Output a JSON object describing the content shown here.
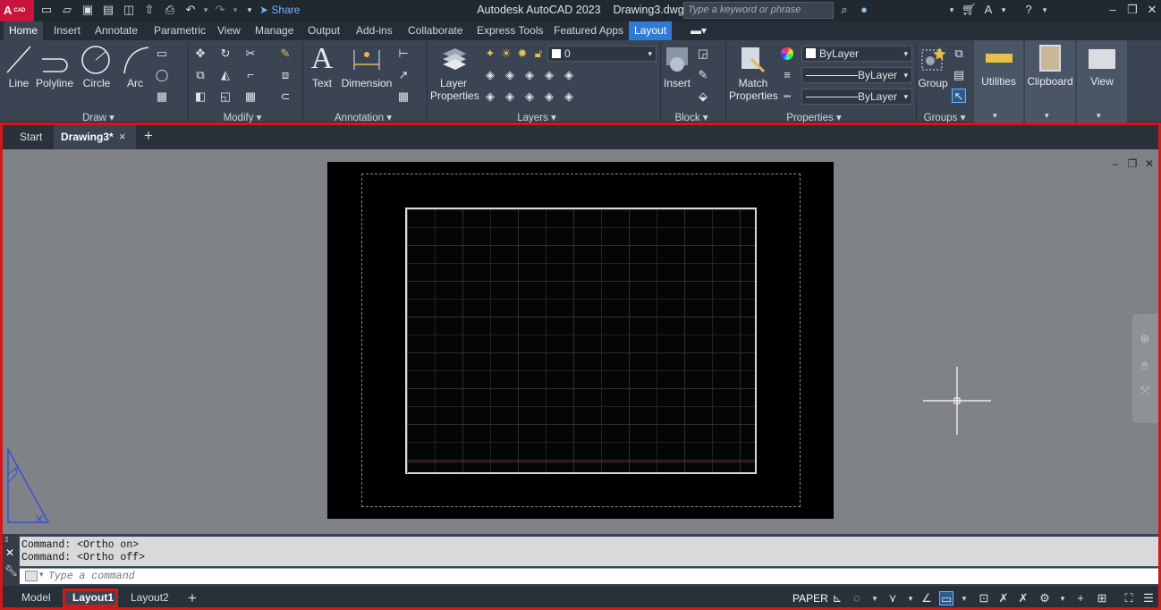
{
  "titlebar": {
    "logo": "A",
    "logo_sub": "CAD",
    "share": "Share",
    "app_title": "Autodesk AutoCAD 2023",
    "file_name": "Drawing3.dwg",
    "search_placeholder": "Type a keyword or phrase"
  },
  "ribbon_tabs": [
    "Home",
    "Insert",
    "Annotate",
    "Parametric",
    "View",
    "Manage",
    "Output",
    "Add-ins",
    "Collaborate",
    "Express Tools",
    "Featured Apps",
    "Layout"
  ],
  "ribbon": {
    "draw": {
      "label": "Draw",
      "line": "Line",
      "polyline": "Polyline",
      "circle": "Circle",
      "arc": "Arc"
    },
    "modify": {
      "label": "Modify"
    },
    "annotation": {
      "label": "Annotation",
      "text": "Text",
      "dimension": "Dimension"
    },
    "layers": {
      "label": "Layers",
      "layer_properties_1": "Layer",
      "layer_properties_2": "Properties",
      "current_layer": "0"
    },
    "block": {
      "label": "Block",
      "insert": "Insert"
    },
    "properties": {
      "label": "Properties",
      "match_1": "Match",
      "match_2": "Properties",
      "color": "ByLayer",
      "linetype": "ByLayer",
      "lineweight": "ByLayer"
    },
    "groups": {
      "label": "Groups",
      "group": "Group"
    },
    "utilities": "Utilities",
    "clipboard": "Clipboard",
    "view": "View"
  },
  "doc_tabs": {
    "start": "Start",
    "active": "Drawing3*",
    "close": "×",
    "add": "+"
  },
  "command": {
    "history": [
      "Command:  <Ortho on>",
      "Command:  <Ortho off>"
    ],
    "placeholder": "Type a command"
  },
  "layout_tabs": {
    "model": "Model",
    "layout1": "Layout1",
    "layout2": "Layout2",
    "add": "+"
  },
  "status": {
    "paper": "PAPER"
  },
  "colors": {
    "accent": "#2f7bd3",
    "highlight": "#d21919",
    "brand": "#c9143d"
  }
}
